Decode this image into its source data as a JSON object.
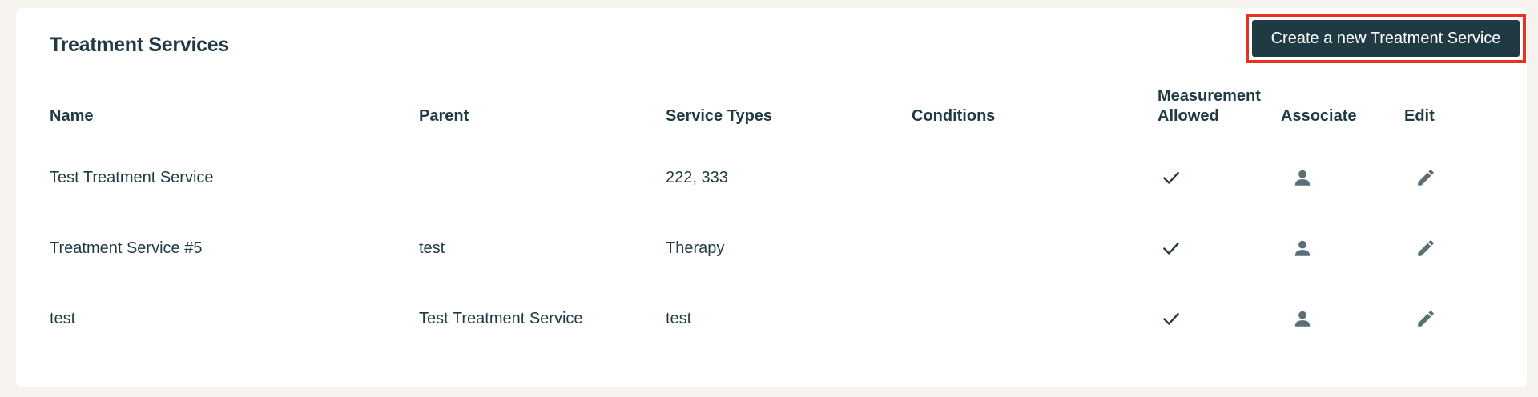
{
  "page": {
    "title": "Treatment Services",
    "create_button_label": "Create a new Treatment Service"
  },
  "table": {
    "columns": [
      "Name",
      "Parent",
      "Service Types",
      "Conditions",
      "Measurement Allowed",
      "Associate",
      "Edit"
    ],
    "rows": [
      {
        "name": "Test Treatment Service",
        "parent": "",
        "service_types": "222, 333",
        "conditions": "",
        "measurement_allowed": true
      },
      {
        "name": "Treatment Service #5",
        "parent": "test",
        "service_types": "Therapy",
        "conditions": "",
        "measurement_allowed": true
      },
      {
        "name": "test",
        "parent": "Test Treatment Service",
        "service_types": "test",
        "conditions": "",
        "measurement_allowed": true
      }
    ]
  },
  "icons": {
    "check": "check-icon",
    "associate": "person-icon",
    "edit": "pencil-icon"
  },
  "colors": {
    "primary": "#1f3a43",
    "icon_gray": "#5a6e76",
    "highlight": "#e8321f",
    "background": "#f6f3ef",
    "card": "#ffffff"
  }
}
